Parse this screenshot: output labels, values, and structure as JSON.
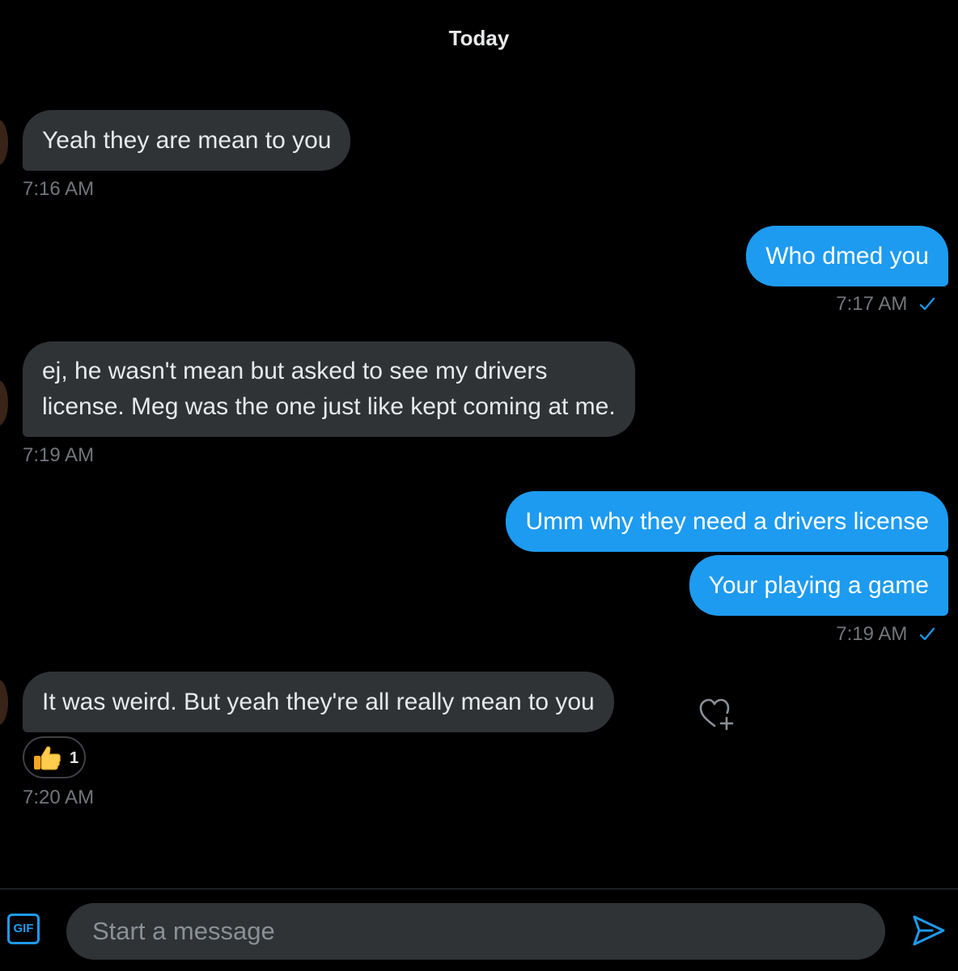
{
  "header": {
    "date_label": "Today"
  },
  "messages": [
    {
      "direction": "in",
      "text": "Yeah they are mean to you",
      "time": "7:16 AM"
    },
    {
      "direction": "out",
      "text": "Who dmed you",
      "time": "7:17 AM"
    },
    {
      "direction": "in",
      "text_line1": "ej, he wasn't mean but asked to see my drivers",
      "text_line2": "license. Meg was the one just like kept coming at me.",
      "time": "7:19 AM"
    },
    {
      "direction": "out",
      "text": "Umm why they need a drivers license"
    },
    {
      "direction": "out",
      "text": "Your playing a game",
      "time": "7:19 AM"
    },
    {
      "direction": "in",
      "text": "It was weird. But yeah they're all really mean to you",
      "time": "7:20 AM",
      "reaction": {
        "emoji": "thumbs-up-icon",
        "count": "1"
      }
    }
  ],
  "composer": {
    "gif_label": "GIF",
    "placeholder": "Start a message"
  },
  "colors": {
    "background": "#000000",
    "incoming_bubble": "#2f3336",
    "outgoing_bubble": "#1d9bf0",
    "timestamp": "#71767b",
    "accent": "#1d9bf0"
  }
}
